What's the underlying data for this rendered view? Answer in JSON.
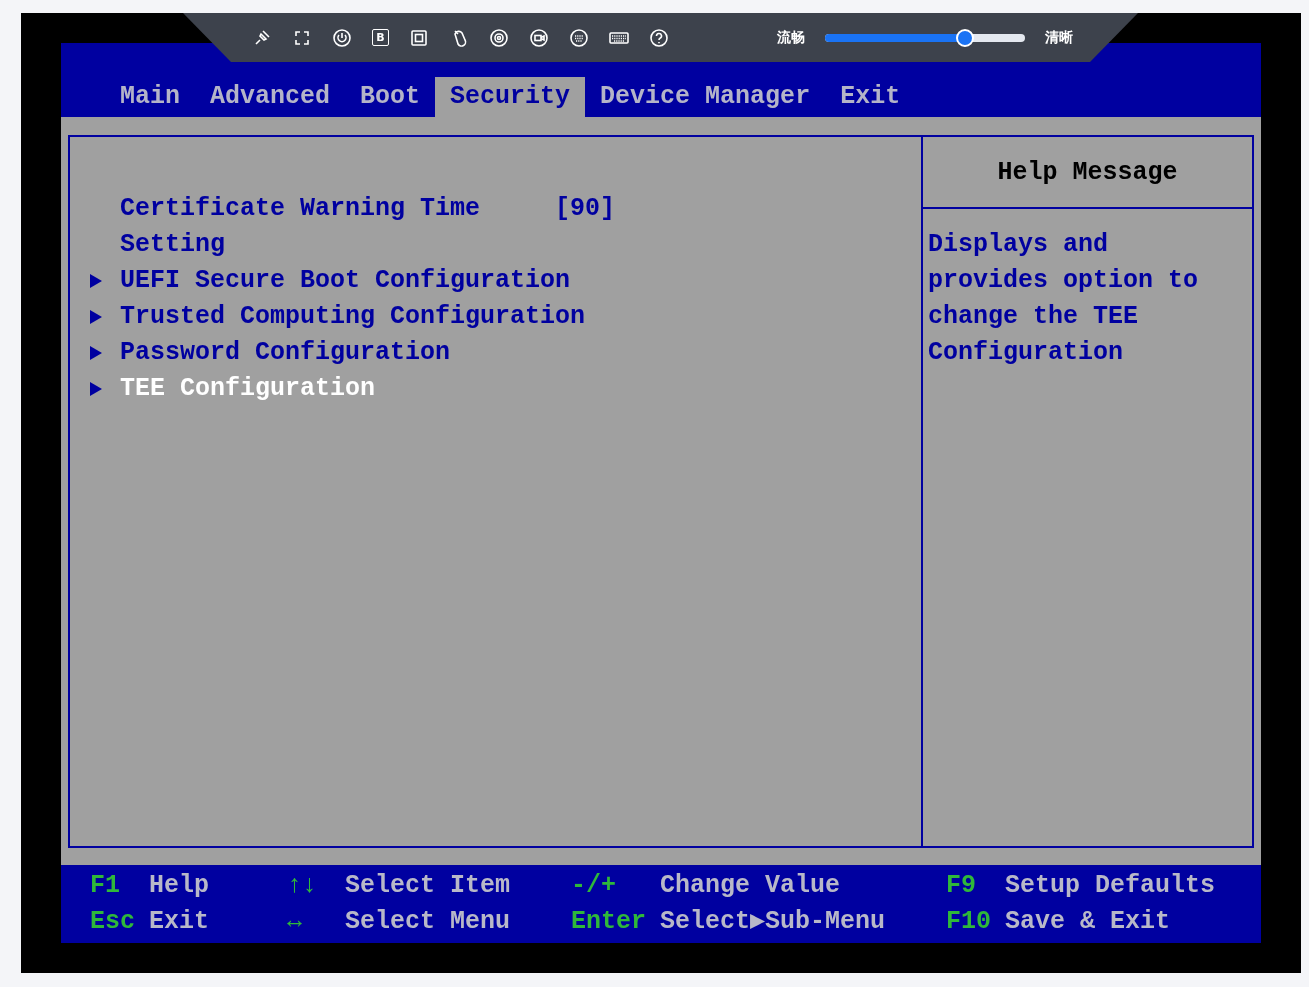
{
  "toolbar": {
    "badge_letter": "B",
    "quality_low": "流畅",
    "quality_high": "清晰",
    "quality": {
      "level": 0.7
    }
  },
  "tabs": [
    {
      "label": "Main",
      "selected": false
    },
    {
      "label": "Advanced",
      "selected": false
    },
    {
      "label": "Boot",
      "selected": false
    },
    {
      "label": "Security",
      "selected": true
    },
    {
      "label": "Device Manager",
      "selected": false
    },
    {
      "label": "Exit",
      "selected": false
    }
  ],
  "menu": [
    {
      "kind": "value",
      "label": "Certificate Warning Time Setting",
      "value": "[90]",
      "selected": false
    },
    {
      "kind": "submenu",
      "label": "UEFI Secure Boot Configuration",
      "selected": false
    },
    {
      "kind": "submenu",
      "label": "Trusted Computing Configuration",
      "selected": false
    },
    {
      "kind": "submenu",
      "label": "Password Configuration",
      "selected": false
    },
    {
      "kind": "submenu",
      "label": "TEE Configuration",
      "selected": true
    }
  ],
  "help": {
    "title": "Help Message",
    "text": "Displays and provides option to change the TEE Configuration"
  },
  "footer": [
    [
      {
        "key": "F1",
        "action": "Help"
      },
      {
        "key": "↑↓",
        "action": "Select Item"
      },
      {
        "key": "-/+",
        "action": "Change Value"
      },
      {
        "key": "F9",
        "action": "Setup Defaults"
      }
    ],
    [
      {
        "key": "Esc",
        "action": "Exit"
      },
      {
        "key": "↔",
        "action": "Select Menu"
      },
      {
        "key": "Enter",
        "action": "Select▶Sub-Menu"
      },
      {
        "key": "F10",
        "action": "Save & Exit"
      }
    ]
  ]
}
